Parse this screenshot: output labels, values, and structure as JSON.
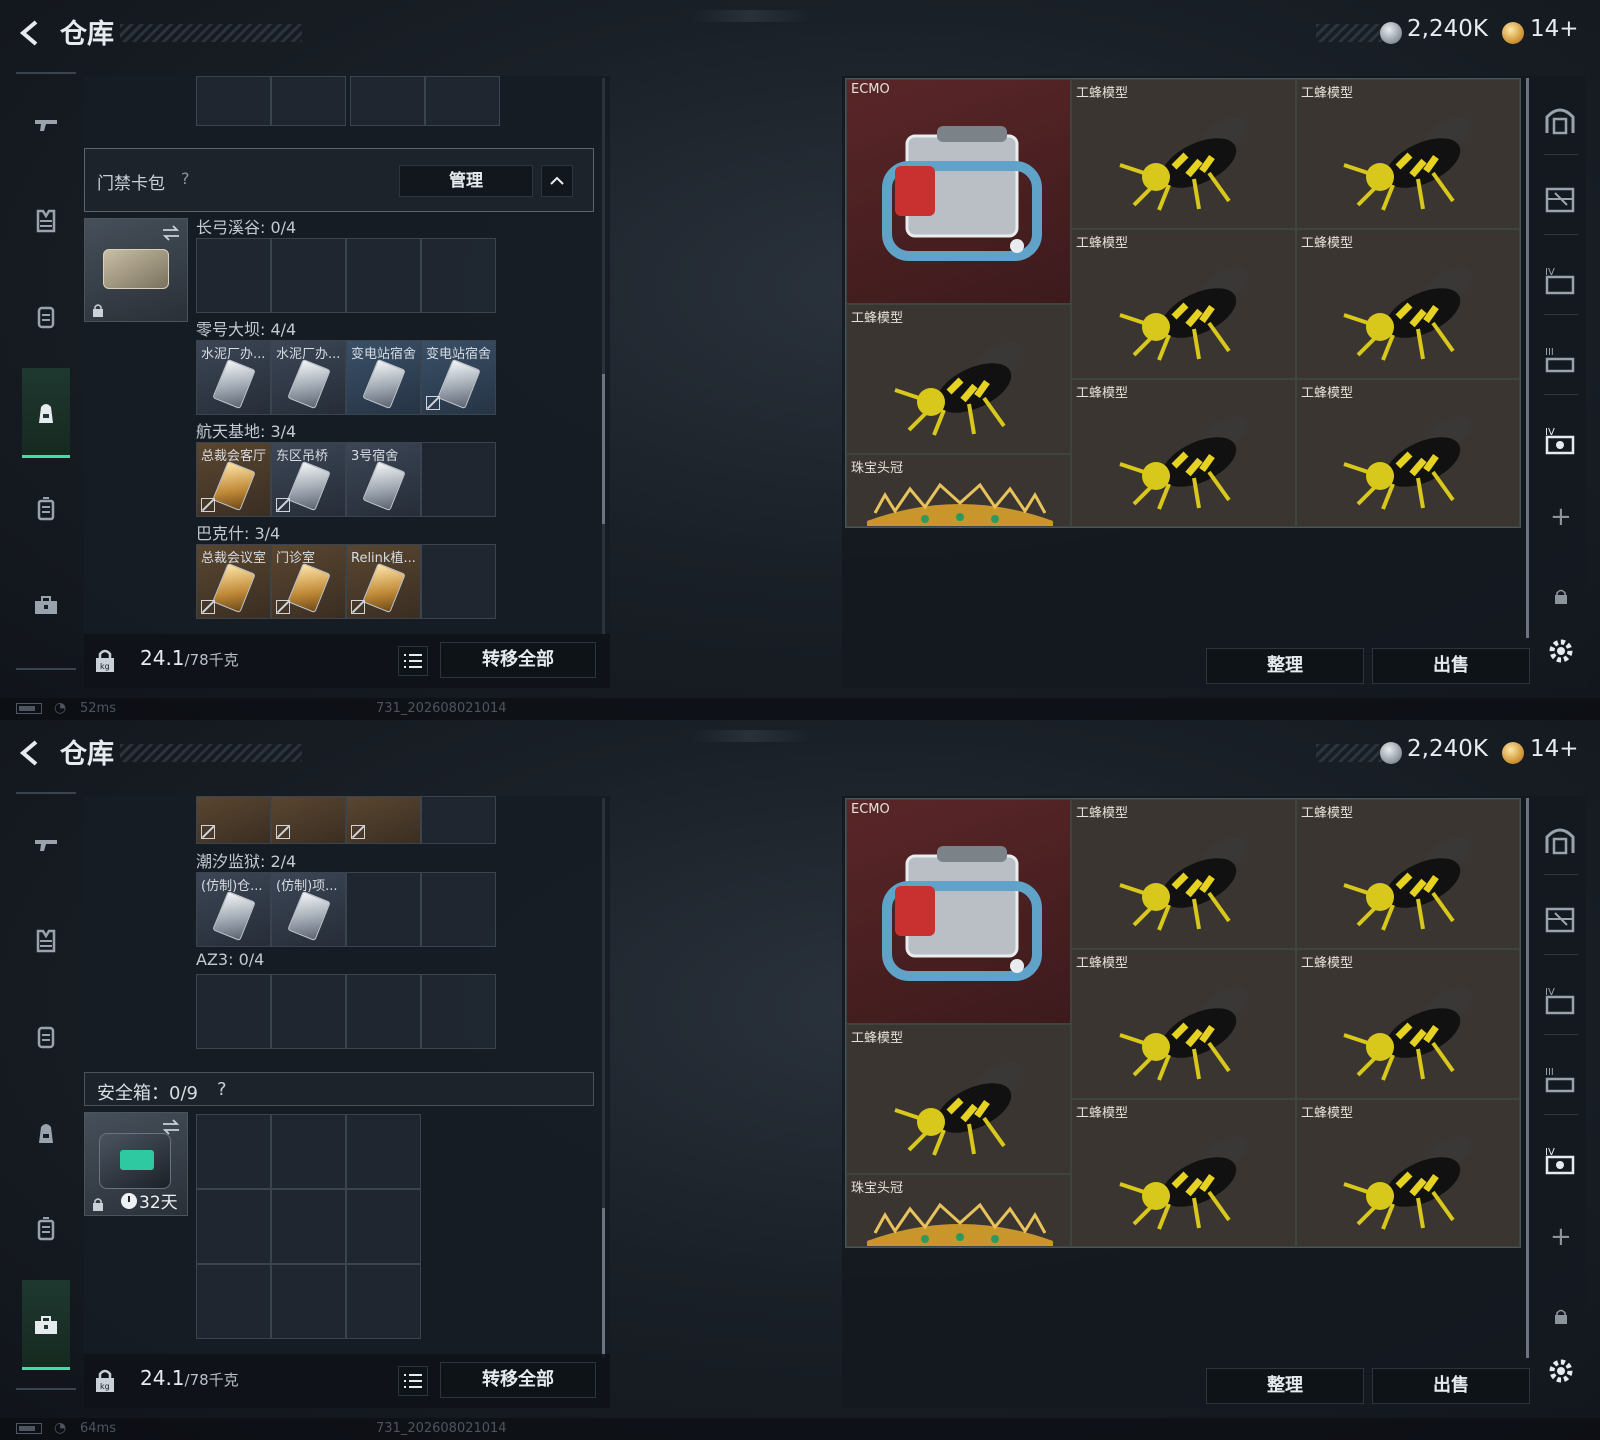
{
  "header": {
    "title": "仓库",
    "silver_amount": "2,240K",
    "gold_amount": "14+"
  },
  "left": {
    "cardpack": {
      "title": "门禁卡包",
      "help": "?",
      "manage_label": "管理"
    },
    "screen1_sections": [
      {
        "label": "长弓溪谷: 0/4",
        "cells": []
      },
      {
        "label": "零号大坝: 4/4",
        "cells": [
          "水泥厂办...",
          "水泥厂办...",
          "变电站宿舍",
          "变电站宿舍"
        ]
      },
      {
        "label": "航天基地: 3/4",
        "cells": [
          "总裁会客厅",
          "东区吊桥",
          "3号宿舍"
        ]
      },
      {
        "label": "巴克什: 3/4",
        "cells": [
          "总裁会议室",
          "门诊室",
          "Relink植..."
        ]
      }
    ],
    "screen2_sections": [
      {
        "label": "潮汐监狱: 2/4",
        "cells": [
          "(仿制)仓...",
          "(仿制)项..."
        ]
      },
      {
        "label": "AZ3: 0/4",
        "cells": []
      }
    ],
    "safebox": {
      "title": "安全箱：",
      "count": "0/9",
      "help": "?",
      "timer": "32天"
    },
    "weight_value": "24.1",
    "weight_max": "/78千克",
    "transfer_label": "转移全部"
  },
  "status": {
    "ping_1": "52ms",
    "ping_2": "64ms",
    "version": "731_202608021014"
  },
  "right": {
    "items": [
      {
        "label": "ECMO"
      },
      {
        "label": "工蜂模型"
      },
      {
        "label": "工蜂模型"
      },
      {
        "label": "工蜂模型"
      },
      {
        "label": "工蜂模型"
      },
      {
        "label": "工蜂模型"
      },
      {
        "label": "工蜂模型"
      },
      {
        "label": "工蜂模型"
      },
      {
        "label": "珠宝头冠"
      }
    ],
    "sort_label": "整理",
    "sell_label": "出售",
    "plus": "+"
  },
  "colors": {
    "accent": "#3fe0a8",
    "panel": "#161c24",
    "item_bg": "#3a3530",
    "ecmo_bg": "#5a2628"
  },
  "icons": {
    "nav": [
      "gun-icon",
      "armor-icon",
      "vest-icon",
      "backpack-icon",
      "case-icon",
      "toolbox-icon"
    ],
    "rail": [
      "helmet-rack-icon",
      "shelf-2-icon",
      "shelf-4-icon",
      "shelf-3-icon",
      "shelf-1-icon"
    ]
  }
}
